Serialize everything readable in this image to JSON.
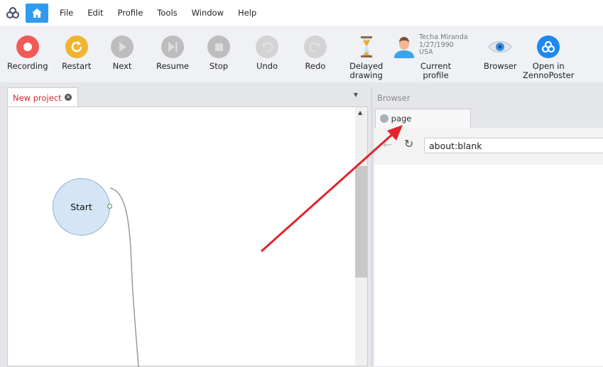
{
  "menu": {
    "items": [
      "File",
      "Edit",
      "Profile",
      "Tools",
      "Window",
      "Help"
    ]
  },
  "toolbar": {
    "recording": "Recording",
    "restart": "Restart",
    "next": "Next",
    "resume": "Resume",
    "stop": "Stop",
    "undo": "Undo",
    "redo": "Redo",
    "delayed_line1": "Delayed",
    "delayed_line2": "drawing",
    "current_profile": "Current profile",
    "browser": "Browser",
    "open_line1": "Open in",
    "open_line2": "ZennoPoster"
  },
  "profile": {
    "name": "Techa Miranda",
    "dob": "1/27/1990",
    "country": "USA"
  },
  "project": {
    "tab": "New project",
    "start_node": "Start"
  },
  "browser": {
    "panel_title": "Browser",
    "tab": "page",
    "url": "about:blank"
  },
  "colors": {
    "accent": "#2e9bf0",
    "record": "#f25a55",
    "restart": "#f0b432",
    "arrow": "#e3232b"
  }
}
